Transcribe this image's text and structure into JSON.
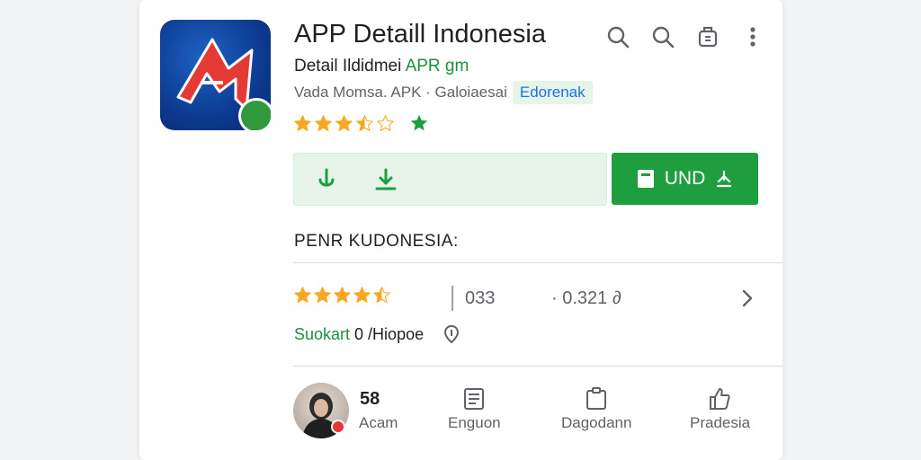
{
  "header": {
    "title": "APP Detaill Indonesia",
    "subtitle_prefix": "Detail Ildidmei",
    "subtitle_highlight": "APR gm",
    "meta_text": "Vada Momsa. APK · Galoiaesai",
    "tag": "Edorenak",
    "icons": [
      "search-icon",
      "search-icon",
      "share-icon",
      "more-vert-icon"
    ]
  },
  "rating_header": {
    "stars_filled": 3.5,
    "stars_total": 5,
    "extra_icon": "green-star-icon"
  },
  "actions": {
    "icons": [
      "download-arrow-icon",
      "download-tray-icon"
    ],
    "install_label": "UND",
    "install_icon": "book-icon",
    "install_trailing_icon": "person-pin-icon"
  },
  "section": {
    "title": "PENR KUDONESIA:"
  },
  "stats_row": {
    "stars_filled": 4.5,
    "stars_total": 5,
    "count": "033",
    "size": "· 0.321 ∂",
    "chevron": "chevron-right-icon"
  },
  "developer": {
    "name": "Suokart",
    "rest": " 0 /Hiopoe",
    "icon": "pin-icon"
  },
  "bottom": {
    "avatar_number": "58",
    "avatar_label": "Acam",
    "items": [
      {
        "label": "Enguon",
        "icon": "document-icon"
      },
      {
        "label": "Dagodann",
        "icon": "clipboard-icon"
      },
      {
        "label": "Pradesia",
        "icon": "thumbs-up-icon"
      }
    ]
  },
  "colors": {
    "accent_green": "#1e9e3e",
    "star_gold": "#f6a823",
    "link_blue": "#1a73e8"
  }
}
